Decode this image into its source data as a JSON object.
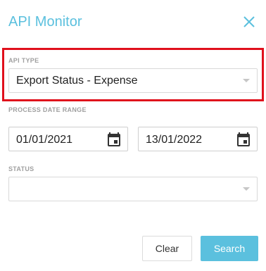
{
  "dialog": {
    "title": "API Monitor",
    "close_icon": "close-icon"
  },
  "api_type": {
    "label": "API TYPE",
    "value": "Export Status - Expense",
    "highlight_color": "#e0101c"
  },
  "process_date_range": {
    "label": "PROCESS DATE RANGE",
    "start": "01/01/2021",
    "end": "13/01/2022",
    "icon": "calendar-icon"
  },
  "status": {
    "label": "STATUS",
    "value": ""
  },
  "buttons": {
    "clear": "Clear",
    "search": "Search"
  },
  "colors": {
    "accent": "#5bc0de",
    "label": "#a0a0a0"
  }
}
